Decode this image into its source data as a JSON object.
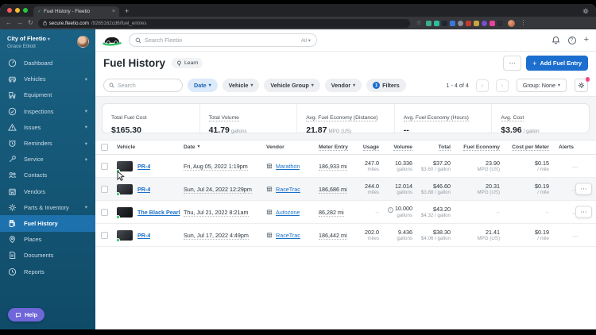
{
  "colors": {
    "accent": "#1c6fce",
    "sidebar_top": "#1a6183",
    "sidebar_bottom": "#0f4b68",
    "selected_nav": "#1d71ad",
    "link": "#1a70c7",
    "status_green": "#23c45e",
    "notify_dot": "#ee4a81",
    "help_purple": "#6f66d9"
  },
  "browser": {
    "tab_title": "Fuel History - Fleetio",
    "url_host": "secure.fleetio.com",
    "url_path": "/9265162cd6/fuel_entries"
  },
  "sidebar": {
    "account": "City of Fleetio",
    "user": "Grace Elliott",
    "items": [
      {
        "label": "Dashboard"
      },
      {
        "label": "Vehicles"
      },
      {
        "label": "Equipment"
      },
      {
        "label": "Inspections"
      },
      {
        "label": "Issues"
      },
      {
        "label": "Reminders"
      },
      {
        "label": "Service"
      },
      {
        "label": "Contacts"
      },
      {
        "label": "Vendors"
      },
      {
        "label": "Parts & Inventory"
      },
      {
        "label": "Fuel History"
      },
      {
        "label": "Places"
      },
      {
        "label": "Documents"
      },
      {
        "label": "Reports"
      }
    ],
    "help_label": "Help"
  },
  "topbar": {
    "search_placeholder": "Search Fleetio",
    "scope": "All"
  },
  "page": {
    "title": "Fuel History",
    "learn_label": "Learn",
    "add_button": "Add Fuel Entry"
  },
  "filters": {
    "search_placeholder": "Search",
    "date": "Date",
    "vehicle": "Vehicle",
    "vehicle_group": "Vehicle Group",
    "vendor": "Vendor",
    "filters_count": "1",
    "filters_label": "Filters",
    "range": "1 - 4 of 4",
    "group_label": "Group: None"
  },
  "stats": {
    "items": [
      {
        "label": "Total Fuel Cost",
        "value": "$165.30",
        "unit": ""
      },
      {
        "label": "Total Volume",
        "value": "41.79",
        "unit": "gallons"
      },
      {
        "label": "Avg. Fuel Economy (Distance)",
        "value": "21.87",
        "unit": "MPG (US)"
      },
      {
        "label": "Avg. Fuel Economy (Hours)",
        "value": "--",
        "unit": ""
      },
      {
        "label": "Avg. Cost",
        "value": "$3.96",
        "unit": "/ gallon"
      }
    ]
  },
  "table": {
    "columns": [
      "Vehicle",
      "Date",
      "Vendor",
      "Meter Entry",
      "Usage",
      "Volume",
      "Total",
      "Fuel Economy",
      "Cost per Meter",
      "Alerts"
    ],
    "rows": [
      {
        "vehicle": "PR-4",
        "date": "Fri, Aug 05, 2022 1:19pm",
        "vendor": "Marathon",
        "meter": "186,933 mi",
        "usage": "247.0",
        "usage_unit": "miles",
        "volume": "10.336",
        "volume_unit": "gallons",
        "total": "$37.20",
        "total_sub": "$3.60 / gallon",
        "economy": "23.90",
        "economy_unit": "MPG (US)",
        "cost": "$0.15",
        "cost_unit": "/ mile",
        "alerts": "—"
      },
      {
        "vehicle": "PR-4",
        "date": "Sun, Jul 24, 2022 12:29pm",
        "vendor": "RaceTrac",
        "meter": "186,686 mi",
        "usage": "244.0",
        "usage_unit": "miles",
        "volume": "12.014",
        "volume_unit": "gallons",
        "total": "$46.60",
        "total_sub": "$3.88 / gallon",
        "economy": "20.31",
        "economy_unit": "MPG (US)",
        "cost": "$0.19",
        "cost_unit": "/ mile",
        "alerts": "—"
      },
      {
        "vehicle": "The Black Pearl",
        "date": "Thu, Jul 21, 2022 8:21am",
        "vendor": "Autozone",
        "meter": "86,282 mi",
        "usage": "--",
        "usage_unit": "",
        "volume": "10.000",
        "volume_unit": "gallons",
        "total": "$43.20",
        "total_sub": "$4.32 / gallon",
        "economy": "--",
        "economy_unit": "",
        "cost": "--",
        "cost_unit": "",
        "alerts": "—"
      },
      {
        "vehicle": "PR-4",
        "date": "Sun, Jul 17, 2022 4:49pm",
        "vendor": "RaceTrac",
        "meter": "186,442 mi",
        "usage": "202.0",
        "usage_unit": "miles",
        "volume": "9.436",
        "volume_unit": "gallons",
        "total": "$38.30",
        "total_sub": "$4.06 / gallon",
        "economy": "21.41",
        "economy_unit": "MPG (US)",
        "cost": "$0.19",
        "cost_unit": "/ mile",
        "alerts": "—"
      }
    ]
  }
}
